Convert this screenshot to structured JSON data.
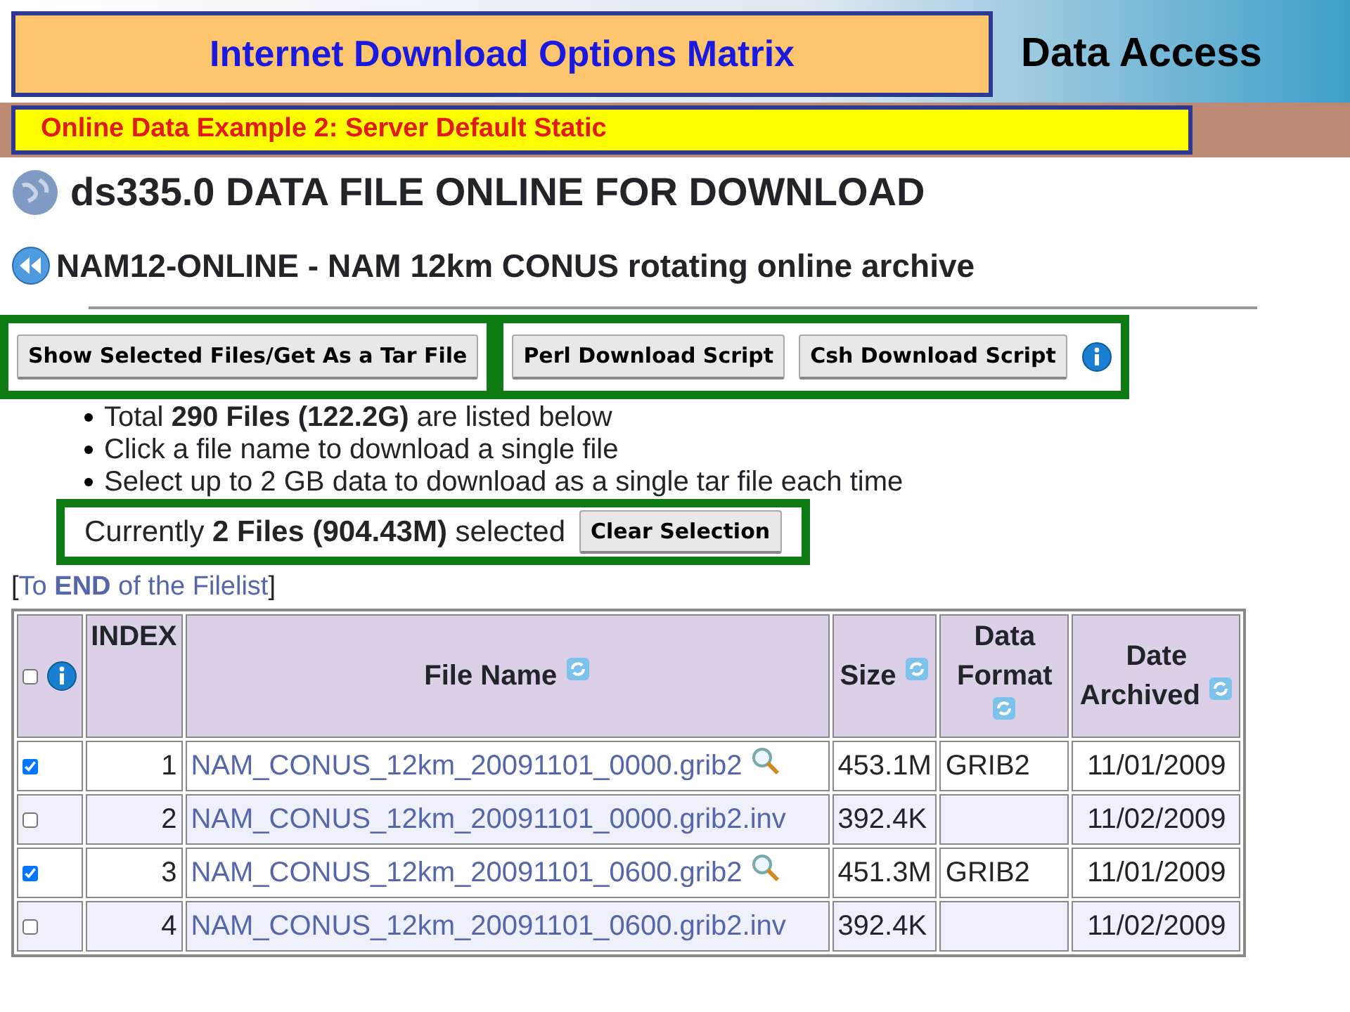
{
  "slide": {
    "title": "Internet Download Options Matrix",
    "section": "Data Access",
    "subtitle": "Online Data Example 2: Server Default Static"
  },
  "page": {
    "dataset": "ds335.0",
    "heading": "DATA FILE ONLINE FOR DOWNLOAD",
    "subtitle": "NAM12-ONLINE - NAM 12km CONUS rotating online archive"
  },
  "button_groups": [
    {
      "buttons": [
        "Show Selected Files/Get As a Tar File"
      ],
      "info": false
    },
    {
      "buttons": [
        "Perl Download Script",
        "Csh Download Script"
      ],
      "info": true
    }
  ],
  "bullets": [
    "Total **290 Files (122.2G)** are listed below",
    "Click a file name to download a single file",
    "Select up to 2 GB data to download as a single tar file each time"
  ],
  "selection": {
    "text": "Currently **2 Files (904.43M)** selected",
    "button": "Clear Selection"
  },
  "end_link": {
    "open": "[",
    "text": "To **END** of the Filelist",
    "close": "]"
  },
  "table": {
    "select_all": false,
    "columns": [
      {
        "label": "INDEX",
        "sortable": false
      },
      {
        "label": "File Name",
        "sortable": true
      },
      {
        "label": "Size",
        "sortable": true
      },
      {
        "label": "Data Format",
        "sortable": true
      },
      {
        "label": "Date Archived",
        "sortable": true
      }
    ],
    "rows": [
      {
        "checked": true,
        "index": "1",
        "file": "NAM_CONUS_12km_20091101_0000.grib2",
        "preview": true,
        "size": "453.1M",
        "format": "GRIB2",
        "date": "11/01/2009"
      },
      {
        "checked": false,
        "index": "2",
        "file": "NAM_CONUS_12km_20091101_0000.grib2.inv",
        "preview": false,
        "size": "392.4K",
        "format": "",
        "date": "11/02/2009"
      },
      {
        "checked": true,
        "index": "3",
        "file": "NAM_CONUS_12km_20091101_0600.grib2",
        "preview": true,
        "size": "451.3M",
        "format": "GRIB2",
        "date": "11/01/2009"
      },
      {
        "checked": false,
        "index": "4",
        "file": "NAM_CONUS_12km_20091101_0600.grib2.inv",
        "preview": false,
        "size": "392.4K",
        "format": "",
        "date": "11/02/2009"
      }
    ]
  }
}
